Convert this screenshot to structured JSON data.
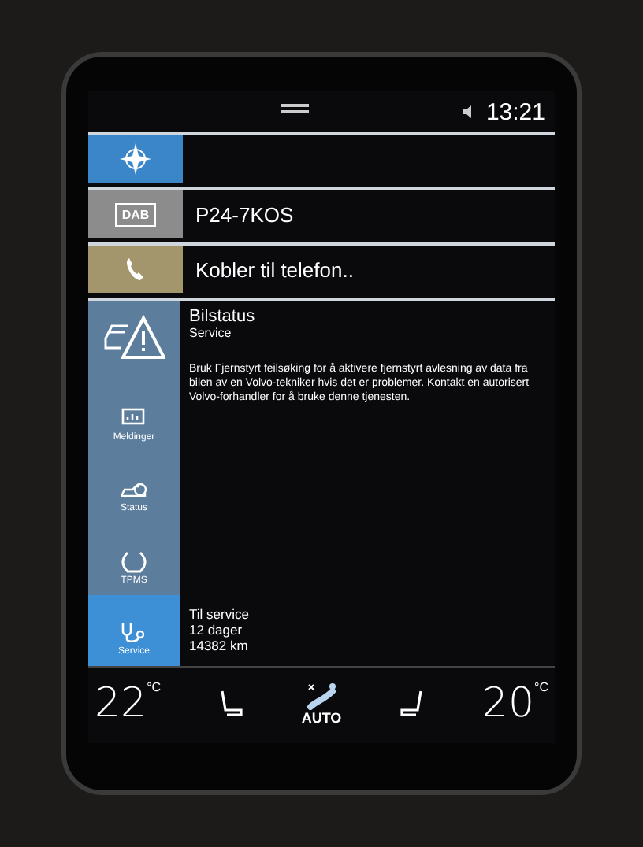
{
  "status_bar": {
    "time": "13:21"
  },
  "tiles": [
    {
      "kind": "navigation",
      "color": "#3a86c8"
    },
    {
      "kind": "radio",
      "color": "#8c8c8c",
      "icon_label": "DAB",
      "text": "P24-7KOS"
    },
    {
      "kind": "phone",
      "color": "#a3966c",
      "text": "Kobler til telefon.."
    }
  ],
  "app": {
    "sidebar": {
      "items": [
        {
          "kind": "messages",
          "label": "Meldinger",
          "selected": false
        },
        {
          "kind": "status",
          "label": "Status",
          "selected": false
        },
        {
          "kind": "tpms",
          "label": "TPMS",
          "selected": false
        },
        {
          "kind": "service",
          "label": "Service",
          "selected": true
        }
      ]
    },
    "title": "Bilstatus",
    "subtitle": "Service",
    "message": "Bruk Fjernstyrt feilsøking for å aktivere fjernstyrt avlesning av data fra bilen av en Volvo-tekniker hvis det er problemer. Kontakt en autorisert Volvo-forhandler for å bruke denne tjenesten.",
    "service_due": [
      "Til service",
      "12 dager",
      "14382 km"
    ]
  },
  "climate": {
    "driver_temp": "22",
    "driver_unit": "°C",
    "fan_mode": "AUTO",
    "passenger_temp": "20",
    "passenger_unit": "°C"
  }
}
